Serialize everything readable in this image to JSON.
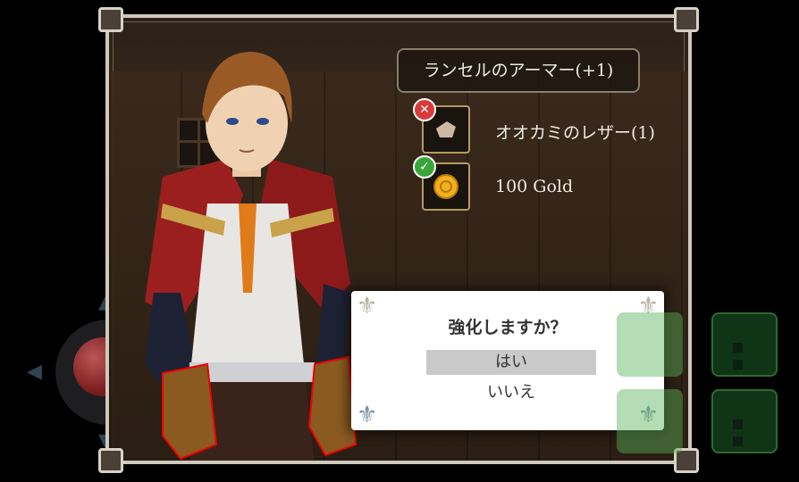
{
  "item": {
    "title": "ランセルのアーマー(+1)"
  },
  "materials": [
    {
      "label": "オオカミのレザー(1)",
      "status": "missing",
      "status_icon": "✕",
      "icon": "wolf-leather-icon"
    },
    {
      "label": "100 Gold",
      "status": "ok",
      "status_icon": "✓",
      "icon": "gold-coin-icon"
    }
  ],
  "dialog": {
    "question": "強化しますか？",
    "options": [
      "はい",
      "いいえ"
    ],
    "selected_index": 0
  },
  "colors": {
    "frame": "#cfc9bd",
    "missing_badge": "#d63a3a",
    "ok_badge": "#3aa63a",
    "touch_button": "#2e7d32"
  }
}
